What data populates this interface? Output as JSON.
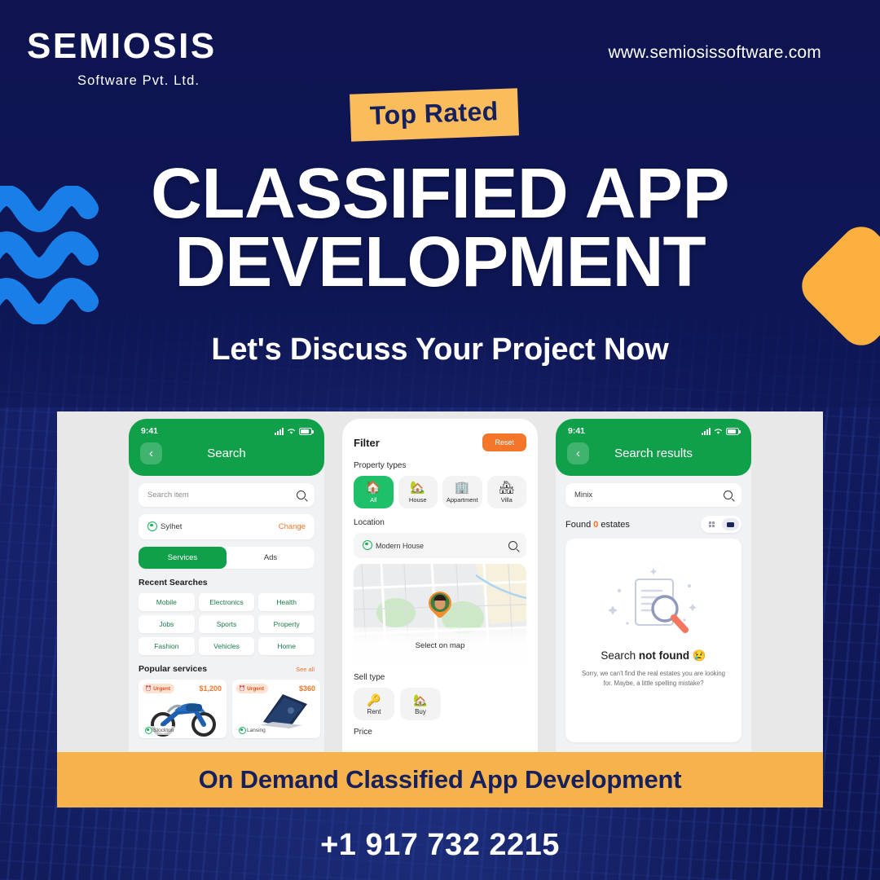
{
  "brand": {
    "logo_text": "SEMIOSIS",
    "logo_subtitle": "Software Pvt. Ltd.",
    "website": "www.semiosissoftware.com",
    "navy": "#0f1757",
    "orange": "#f6b24b",
    "blue_accent": "#1a7ee8",
    "green": "#11a04a"
  },
  "hero": {
    "badge": "Top Rated",
    "headline_line1": "CLASSIFIED APP",
    "headline_line2": "DEVELOPMENT",
    "subheadline": "Let's Discuss Your Project Now"
  },
  "phone_search": {
    "status_time": "9:41",
    "header_title": "Search",
    "back_icon": "chevron-left-icon",
    "search_placeholder": "Search item",
    "location_value": "Sylhet",
    "location_change": "Change",
    "tabs": [
      {
        "label": "Services",
        "selected": true
      },
      {
        "label": "Ads",
        "selected": false
      }
    ],
    "recent_searches_title": "Recent Searches",
    "recent_searches": [
      "Mobile",
      "Electronics",
      "Health",
      "Jobs",
      "Sports",
      "Property",
      "Fashion",
      "Vehicles",
      "Home"
    ],
    "popular_title": "Popular services",
    "see_all": "See all",
    "products": [
      {
        "badge": "Urgent",
        "price": "$1,200",
        "place": "Stockton",
        "kind": "motorcycle"
      },
      {
        "badge": "Urgent",
        "price": "$360",
        "place": "Lansing",
        "kind": "laptop"
      }
    ]
  },
  "phone_filter": {
    "title": "Filter",
    "reset_label": "Reset",
    "property_types_label": "Property types",
    "property_types": [
      {
        "label": "All",
        "icon": "🏠",
        "selected": true
      },
      {
        "label": "House",
        "icon": "🏡",
        "selected": false
      },
      {
        "label": "Appartment",
        "icon": "🏢",
        "selected": false
      },
      {
        "label": "Villa",
        "icon": "🏘",
        "selected": false
      }
    ],
    "location_label": "Location",
    "location_value": "Modern House",
    "select_on_map": "Select on map",
    "sell_type_label": "Sell type",
    "sell_types": [
      {
        "label": "Rent",
        "icon": "🔑"
      },
      {
        "label": "Buy",
        "icon": "🏡"
      }
    ],
    "next_section_label": "Price"
  },
  "phone_results": {
    "status_time": "9:41",
    "header_title": "Search results",
    "back_icon": "chevron-left-icon",
    "search_value": "Minix",
    "found_prefix": "Found ",
    "found_count": "0",
    "found_suffix": " estates",
    "view_grid": "grid-view-icon",
    "view_list": "list-view-icon",
    "not_found_title_normal": "Search ",
    "not_found_title_bold": "not found",
    "not_found_emoji": "😢",
    "not_found_desc": "Sorry, we can't find the real estates you are looking for. Maybe, a little spelling mistake?"
  },
  "footer": {
    "banner_text": "On Demand Classified App Development",
    "phone_number": "+1 917 732 2215"
  }
}
